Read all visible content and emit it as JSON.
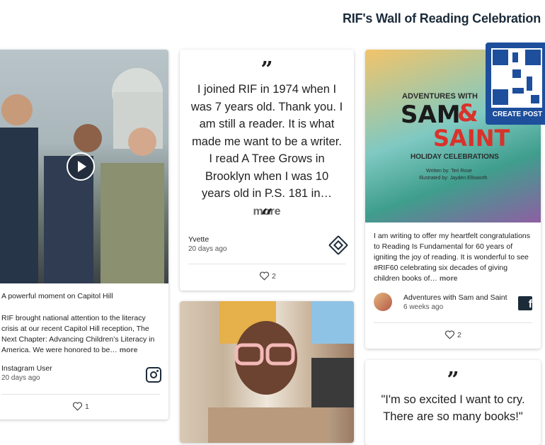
{
  "header": {
    "title": "RIF's Wall of Reading Celebration"
  },
  "qr": {
    "label": "CREATE POST"
  },
  "posts": [
    {
      "caption_title": "A powerful moment on Capitol Hill",
      "body": "RIF brought national attention to the literacy crisis at our recent Capitol Hill reception, The Next Chapter: Advancing Children’s Literacy in America. We were honored to be…",
      "more": "more",
      "author": "Instagram User",
      "time": "20 days ago",
      "likes": "1",
      "source_icon": "instagram-icon"
    },
    {
      "quote_open": "”",
      "quote": "I joined RIF in 1974 when I was 7 years old. Thank you. I am still a reader. It is what made me want to be a writer. I read A Tree Grows in Brooklyn when I was 10 years old in P.S. 181 in…",
      "more": "more",
      "quote_close": "“",
      "author": "Yvette",
      "time": "20 days ago",
      "likes": "2",
      "source_icon": "diamond-logo-icon"
    },
    {
      "book_top": "ADVENTURES WITH",
      "book_sam": "SAM",
      "book_amp": "&",
      "book_saint": "SAINT",
      "book_sub": "HOLIDAY CELEBRATIONS",
      "book_credit1": "Written by: Teri Rose",
      "book_credit2": "Illustrated by: Jayden Ellsworth",
      "body": "I am writing to offer my heartfelt congratulations to Reading Is Fundamental for 60 years of igniting the joy of reading. It is wonderful to see #RIF60 celebrating six decades of giving children books of…",
      "more": "more",
      "author": "Adventures with Sam and Saint",
      "time": "6 weeks ago",
      "likes": "2",
      "source_icon": "facebook-icon"
    },
    {
      "quote_open": "”",
      "quote": "\"I'm so excited I want to cry. There are so many books!\""
    }
  ],
  "colors": {
    "accent": "#1d4f9c",
    "text": "#1c2b3a"
  }
}
